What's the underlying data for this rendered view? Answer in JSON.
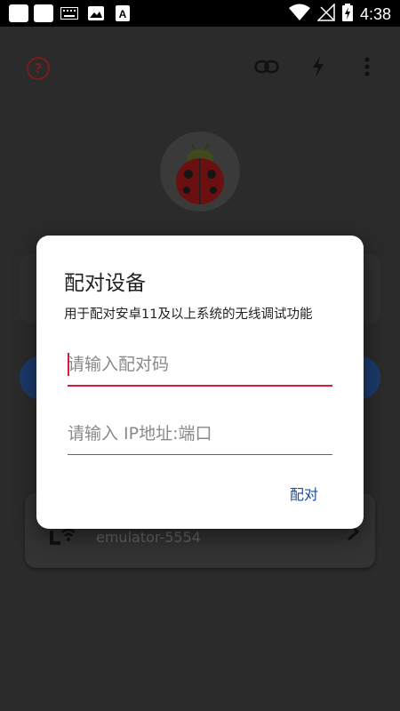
{
  "status_bar": {
    "time": "4:38",
    "icons": [
      "app-icon",
      "app-icon",
      "keyboard-icon",
      "image-icon",
      "font-download-icon",
      "wifi-icon",
      "signal-icon",
      "battery-charging-icon"
    ]
  },
  "app": {
    "device_name": "emulator-5554",
    "icons": [
      "help-icon",
      "link-icon",
      "bolt-icon",
      "more-vert-icon",
      "ladybug-avatar-icon",
      "wifi-adb-icon",
      "chevron-right-icon"
    ]
  },
  "dialog": {
    "title": "配对设备",
    "description": "用于配对安卓11及以上系统的无线调试功能",
    "pair_code_placeholder": "请输入配对码",
    "ip_port_placeholder": "请输入 IP地址:端口",
    "pair_button_label": "配对"
  },
  "colors": {
    "accent": "#d81b3c",
    "button_text": "#1a4a9a"
  }
}
